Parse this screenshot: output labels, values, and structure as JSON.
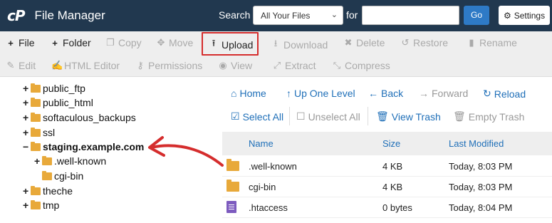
{
  "header": {
    "logo_mark": "cP",
    "title": "File Manager",
    "search_label": "Search",
    "search_scope": "All Your Files",
    "for_label": "for",
    "search_value": "",
    "go_label": "Go",
    "settings_label": "Settings"
  },
  "toolbar": {
    "row1": [
      {
        "label": "File",
        "icon": "plus-icon",
        "state": "enabled"
      },
      {
        "label": "Folder",
        "icon": "plus-icon",
        "state": "enabled"
      },
      {
        "label": "Copy",
        "icon": "copy-icon",
        "state": "disabled"
      },
      {
        "label": "Move",
        "icon": "move-icon",
        "state": "disabled"
      },
      {
        "label": "Upload",
        "icon": "upload-icon",
        "state": "enabled"
      },
      {
        "label": "Download",
        "icon": "download-icon",
        "state": "disabled"
      },
      {
        "label": "Delete",
        "icon": "x-icon",
        "state": "disabled"
      },
      {
        "label": "Restore",
        "icon": "undo-icon",
        "state": "disabled"
      },
      {
        "label": "Rename",
        "icon": "file-icon",
        "state": "disabled"
      }
    ],
    "row2": [
      {
        "label": "Edit",
        "icon": "pencil-icon",
        "state": "disabled"
      },
      {
        "label": "HTML Editor",
        "icon": "edit-icon",
        "state": "disabled"
      },
      {
        "label": "Permissions",
        "icon": "key-icon",
        "state": "disabled"
      },
      {
        "label": "View",
        "icon": "eye-icon",
        "state": "disabled"
      },
      {
        "label": "Extract",
        "icon": "expand-icon",
        "state": "disabled"
      },
      {
        "label": "Compress",
        "icon": "compress-icon",
        "state": "disabled"
      }
    ]
  },
  "tree": {
    "items": [
      {
        "label": "public_ftp",
        "toggle": "+"
      },
      {
        "label": "public_html",
        "toggle": "+"
      },
      {
        "label": "softaculous_backups",
        "toggle": "+"
      },
      {
        "label": "ssl",
        "toggle": "+"
      },
      {
        "label": "staging.example.com",
        "toggle": "−"
      },
      {
        "label": ".well-known",
        "toggle": "+"
      },
      {
        "label": "cgi-bin",
        "toggle": ""
      },
      {
        "label": "theche",
        "toggle": "+"
      },
      {
        "label": "tmp",
        "toggle": "+"
      }
    ]
  },
  "nav": {
    "home": "Home",
    "up": "Up One Level",
    "back": "Back",
    "forward": "Forward",
    "reload": "Reload",
    "select_all": "Select All",
    "unselect_all": "Unselect All",
    "view_trash": "View Trash",
    "empty_trash": "Empty Trash"
  },
  "table": {
    "columns": [
      "Name",
      "Size",
      "Last Modified"
    ],
    "rows": [
      {
        "name": ".well-known",
        "size": "4 KB",
        "modified": "Today, 8:03 PM",
        "type": "folder"
      },
      {
        "name": "cgi-bin",
        "size": "4 KB",
        "modified": "Today, 8:03 PM",
        "type": "folder"
      },
      {
        "name": ".htaccess",
        "size": "0 bytes",
        "modified": "Today, 8:04 PM",
        "type": "text"
      }
    ]
  },
  "colors": {
    "header_bg": "#21384f",
    "accent_blue": "#2e7ac6",
    "link_blue": "#1f6fb8",
    "highlight_red": "#d52d2d",
    "folder_yellow": "#e8a93a",
    "file_purple": "#7d5bbf"
  }
}
